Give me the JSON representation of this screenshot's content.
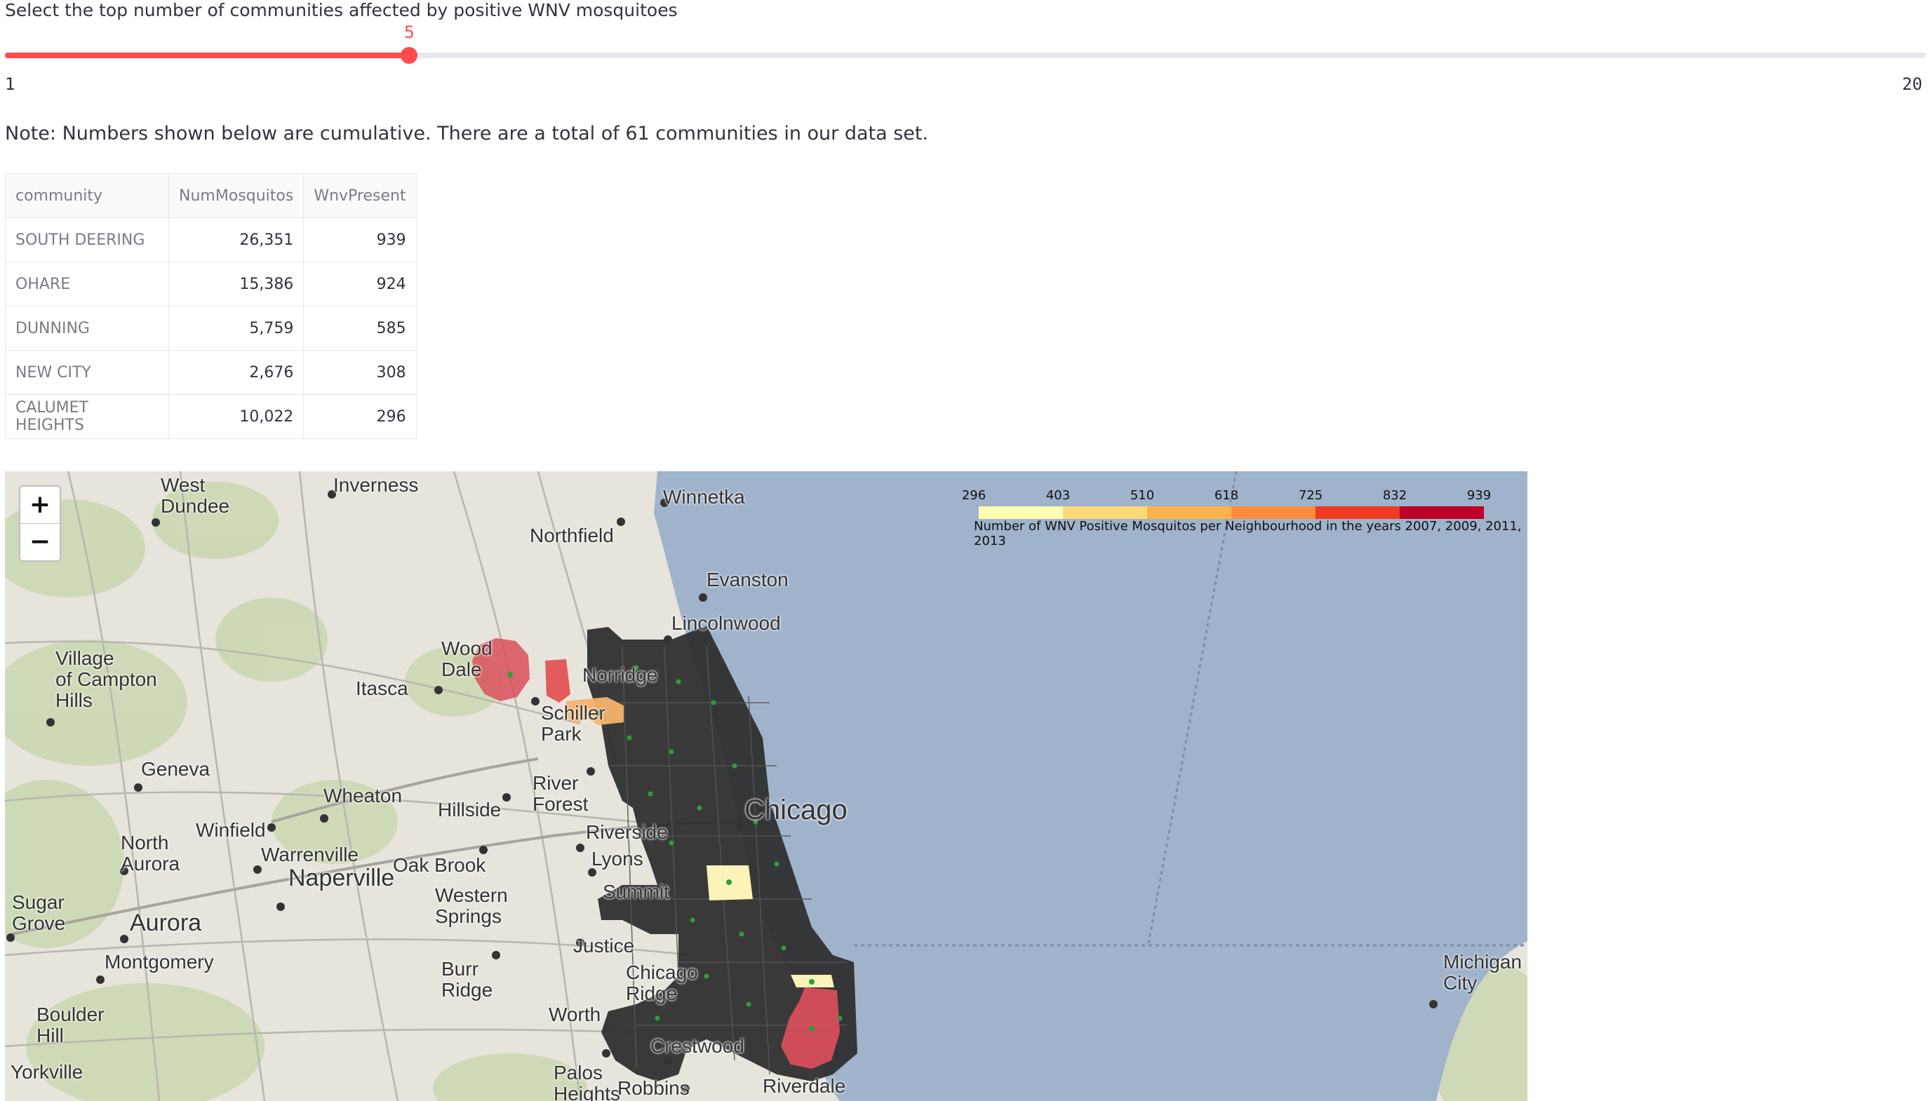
{
  "slider": {
    "label": "Select the top number of communities affected by positive WNV mosquitoes",
    "value": 5,
    "min": 1,
    "max": 20,
    "value_text": "5",
    "min_text": "1",
    "max_text": "20",
    "color": "#ff4b4b"
  },
  "note": "Note: Numbers shown below are cumulative. There are a total of 61 communities in our data set.",
  "table": {
    "columns": [
      "community",
      "NumMosquitos",
      "WnvPresent"
    ],
    "rows": [
      [
        "SOUTH DEERING",
        "26,351",
        "939"
      ],
      [
        "OHARE",
        "15,386",
        "924"
      ],
      [
        "DUNNING",
        "5,759",
        "585"
      ],
      [
        "NEW CITY",
        "2,676",
        "308"
      ],
      [
        "CALUMET HEIGHTS",
        "10,022",
        "296"
      ]
    ]
  },
  "map": {
    "zoom_in": "+",
    "zoom_out": "−",
    "legend": {
      "ticks": [
        "296",
        "403",
        "510",
        "618",
        "725",
        "832",
        "939"
      ],
      "colors": [
        "#ffffb2",
        "#fed976",
        "#feb24c",
        "#fd8d3c",
        "#f03b20",
        "#bd0026"
      ],
      "caption": "Number of WNV Positive Mosquitos per Neighbourhood in the years 2007, 2009, 2011, 2013"
    },
    "places": {
      "west_dundee": "West\nDundee",
      "inverness": "Inverness",
      "winnetka": "Winnetka",
      "northfield": "Northfield",
      "evanston": "Evanston",
      "lincolnwood": "Lincolnwood",
      "village_campton_hills": "Village\nof Campton\nHills",
      "wood_dale": "Wood\nDale",
      "itasca": "Itasca",
      "norridge": "Norridge",
      "schiller_park": "Schiller\nPark",
      "geneva": "Geneva",
      "wheaton": "Wheaton",
      "river_forest": "River\nForest",
      "hillside": "Hillside",
      "chicago": "Chicago",
      "north_aurora": "North\nAurora",
      "winfield": "Winfield",
      "warrenville": "Warrenville",
      "naperville": "Naperville",
      "oak_brook": "Oak Brook",
      "riverside": "Riverside",
      "lyons": "Lyons",
      "summit": "Summit",
      "sugar_grove": "Sugar\nGrove",
      "aurora": "Aurora",
      "western_springs": "Western\nSprings",
      "montgomery": "Montgomery",
      "justice": "Justice",
      "burr_ridge": "Burr\nRidge",
      "chicago_ridge": "Chicago\nRidge",
      "boulder_hill": "Boulder\nHill",
      "worth": "Worth",
      "crestwood": "Crestwood",
      "michigan_city": "Michigan\nCity",
      "yorkville": "Yorkville",
      "palos_heights": "Palos\nHeights",
      "robbins": "Robbins",
      "riverdale": "Riverdale"
    }
  }
}
